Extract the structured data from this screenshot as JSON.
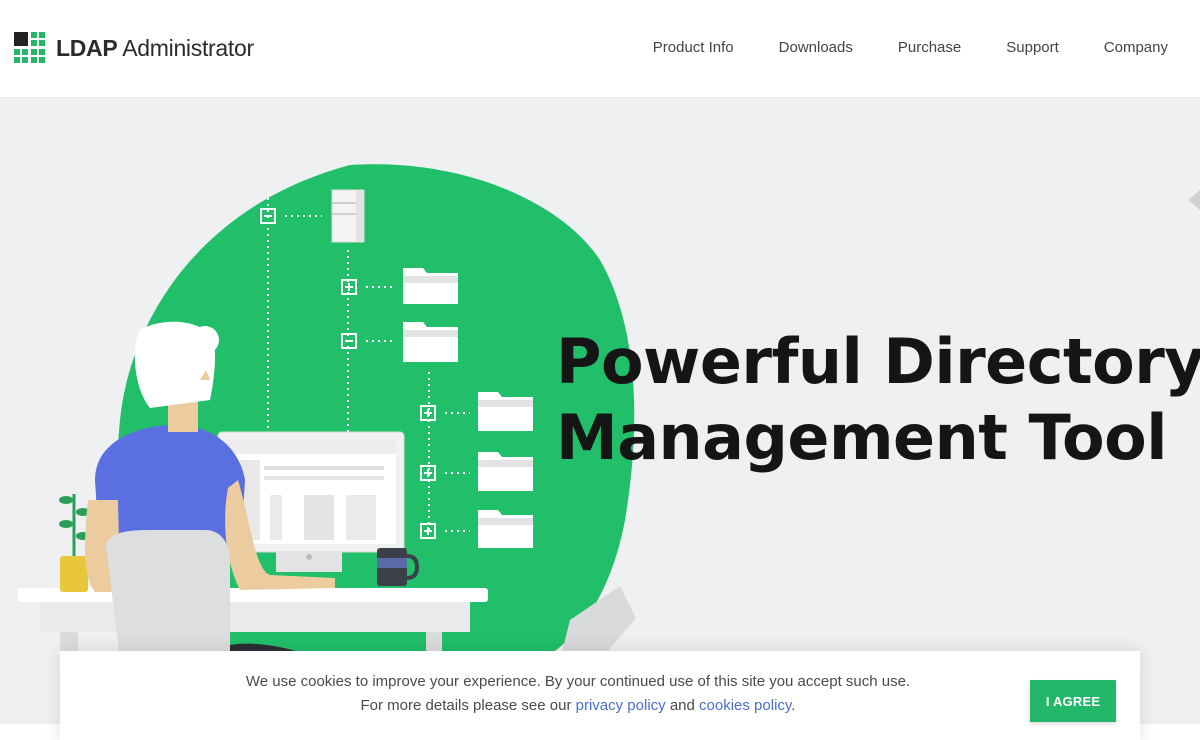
{
  "brand": {
    "name_bold": "LDAP",
    "name_rest": " Administrator"
  },
  "nav": {
    "items": [
      {
        "label": "Product Info"
      },
      {
        "label": "Downloads"
      },
      {
        "label": "Purchase"
      },
      {
        "label": "Support"
      },
      {
        "label": "Company"
      }
    ]
  },
  "hero": {
    "headline_line1": "Powerful Directory",
    "headline_line2": "Management Tool"
  },
  "cookie": {
    "line1": "We use cookies to improve your experience. By your continued use of this site you accept such use.",
    "line2_prefix": "For more details please see our ",
    "privacy_link": "privacy policy",
    "and_text": " and ",
    "cookies_link": "cookies policy",
    "line2_suffix": ".",
    "agree_label": "I AGREE"
  },
  "colors": {
    "accent": "#22b769",
    "background": "#eff0f2",
    "link": "#4a6fd0",
    "headline": "#151515"
  },
  "icons": [
    "logo-grid-icon",
    "folder-icon",
    "server-icon",
    "expand-plus-icon",
    "collapse-minus-icon",
    "mug-icon",
    "plant-icon"
  ]
}
